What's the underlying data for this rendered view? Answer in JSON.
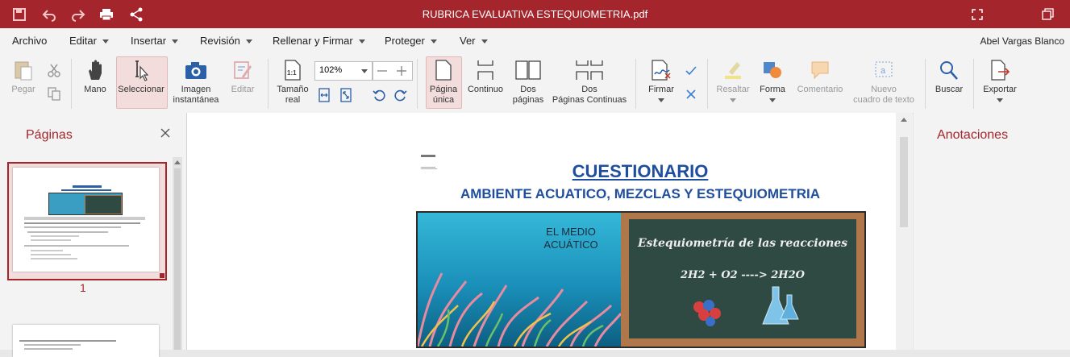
{
  "window": {
    "title": "RUBRICA EVALUATIVA ESTEQUIOMETRIA.pdf"
  },
  "menu": {
    "items": [
      {
        "label": "Archivo"
      },
      {
        "label": "Editar"
      },
      {
        "label": "Insertar"
      },
      {
        "label": "Revisión"
      },
      {
        "label": "Rellenar y Firmar"
      },
      {
        "label": "Proteger"
      },
      {
        "label": "Ver"
      }
    ],
    "user": "Abel Vargas Blanco"
  },
  "ribbon": {
    "paste": "Pegar",
    "hand": "Mano",
    "select": "Seleccionar",
    "snapshot_1": "Imagen",
    "snapshot_2": "instantánea",
    "edit": "Editar",
    "actual_1": "Tamaño",
    "actual_2": "real",
    "zoom": "102%",
    "single_1": "Página",
    "single_2": "única",
    "continuous": "Continuo",
    "two_1": "Dos",
    "two_2": "páginas",
    "twocont_1": "Dos",
    "twocont_2": "Páginas Continuas",
    "sign": "Firmar",
    "highlight": "Resaltar",
    "shape": "Forma",
    "comment": "Comentario",
    "textbox_1": "Nuevo",
    "textbox_2": "cuadro de texto",
    "search": "Buscar",
    "export": "Exportar"
  },
  "left_pane": {
    "title": "Páginas",
    "page_number": "1"
  },
  "right_pane": {
    "title": "Anotaciones"
  },
  "document": {
    "heading": "CUESTIONARIO",
    "subheading": "AMBIENTE ACUATICO, MEZCLAS Y ESTEQUIOMETRIA",
    "banner_left_1": "EL MEDIO",
    "banner_left_2": "ACUÁTICO",
    "board_title": "Estequiometría de las reacciones",
    "board_equation": "2H2 + O2 ----> 2H2O"
  },
  "colors": {
    "accent": "#a4262c",
    "heading_blue": "#1f4e9e"
  }
}
